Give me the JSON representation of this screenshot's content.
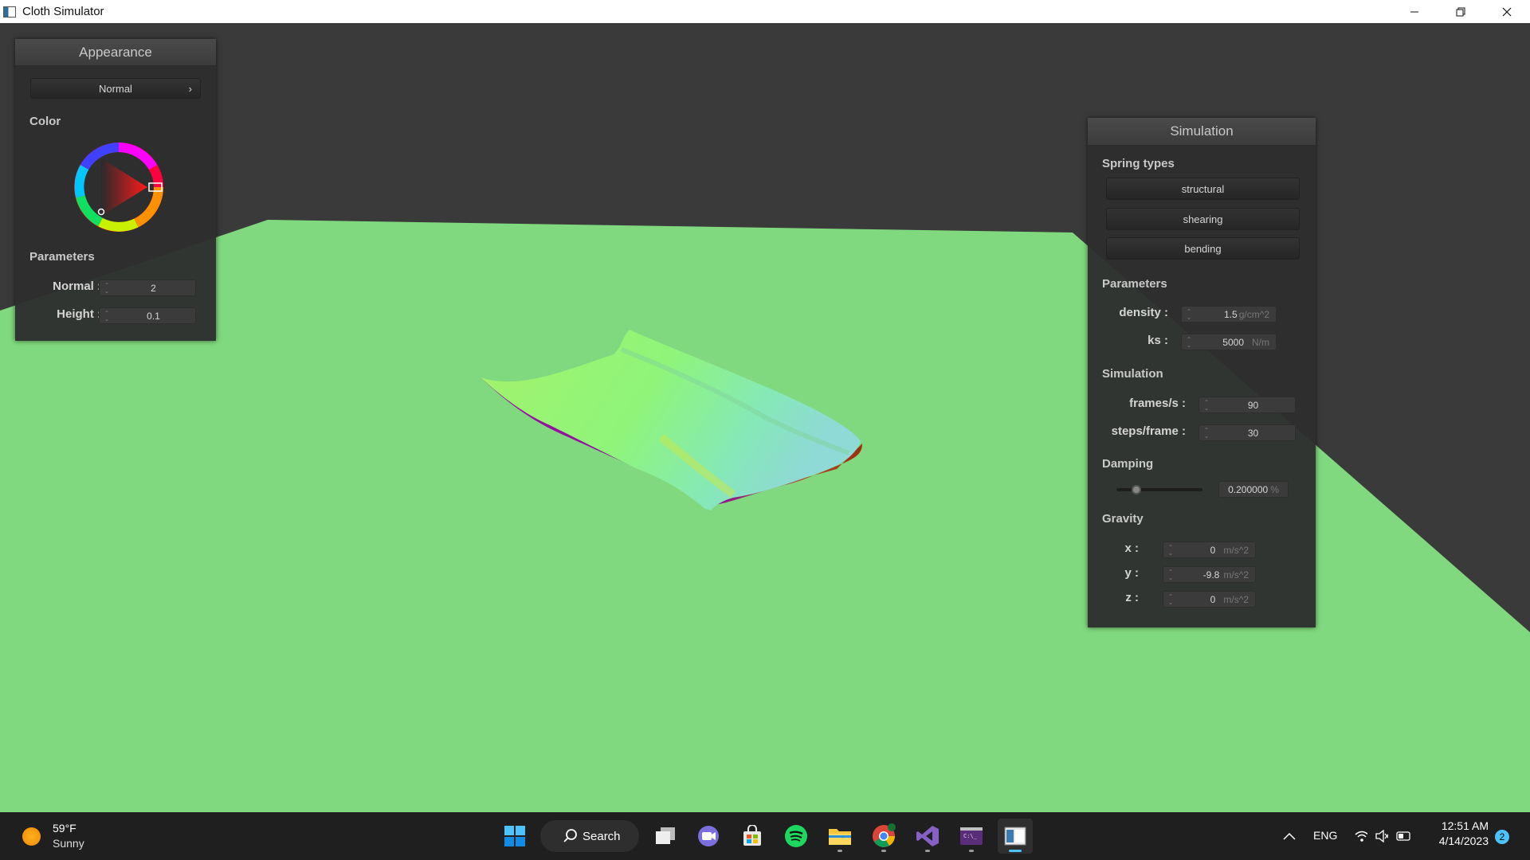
{
  "window": {
    "title": "Cloth Simulator"
  },
  "appearance": {
    "title": "Appearance",
    "mode_selector": "Normal",
    "mode_chevron": "›",
    "color_section": "Color",
    "params_section": "Parameters",
    "normal_label": "Normal :",
    "normal_value": "2",
    "height_label": "Height :",
    "height_value": "0.1"
  },
  "simulation": {
    "title": "Simulation",
    "spring_section": "Spring types",
    "spring_structural": "structural",
    "spring_shearing": "shearing",
    "spring_bending": "bending",
    "params_section": "Parameters",
    "density_label": "density :",
    "density_value": "1.5",
    "density_unit": "g/cm^2",
    "ks_label": "ks :",
    "ks_value": "5000",
    "ks_unit": "N/m",
    "sim_section": "Simulation",
    "fps_label": "frames/s :",
    "fps_value": "90",
    "steps_label": "steps/frame :",
    "steps_value": "30",
    "damping_section": "Damping",
    "damping_value": "0.200000",
    "damping_unit": "%",
    "damping_level": 0.2,
    "gravity_section": "Gravity",
    "gx_label": "x :",
    "gx_value": "0",
    "gy_label": "y :",
    "gy_value": "-9.8",
    "gz_label": "z :",
    "gz_value": "0",
    "gravity_unit": "m/s^2"
  },
  "taskbar": {
    "weather_temp": "59°F",
    "weather_desc": "Sunny",
    "search_label": "Search",
    "language": "ENG",
    "time": "12:51 AM",
    "date": "4/14/2023",
    "notification_count": "2"
  },
  "colors": {
    "floor": "#80d97e",
    "background": "#3a3a3a",
    "panel": "#2e2e2e",
    "accent": "#0078d4"
  }
}
